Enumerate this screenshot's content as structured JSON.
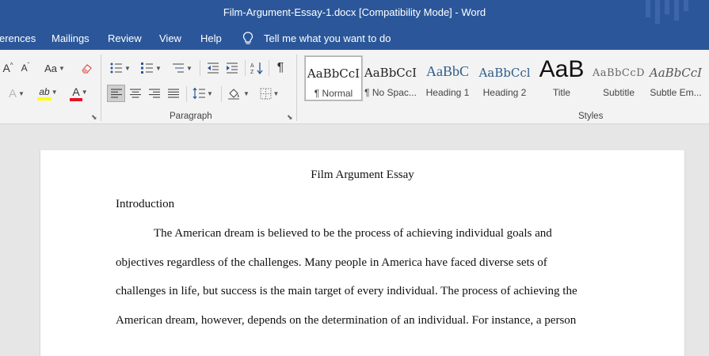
{
  "window": {
    "title": "Film-Argument-Essay-1.docx [Compatibility Mode]  -  Word"
  },
  "menu": {
    "items": [
      "erences",
      "Mailings",
      "Review",
      "View",
      "Help"
    ],
    "tell_me": "Tell me what you want to do"
  },
  "ribbon": {
    "groups": {
      "paragraph": "Paragraph",
      "styles": "Styles"
    },
    "font_buttons": {
      "grow": "A",
      "shrink": "A",
      "case": "Aa",
      "effects": "A",
      "highlight": "ab",
      "font_color": "A"
    },
    "pilcrow": "¶",
    "styles": [
      {
        "preview": "AaBbCcI",
        "name": "¶ Normal"
      },
      {
        "preview": "AaBbCcI",
        "name": "¶ No Spac..."
      },
      {
        "preview": "AaBbC",
        "name": "Heading 1"
      },
      {
        "preview": "AaBbCcl",
        "name": "Heading 2"
      },
      {
        "preview": "AaB",
        "name": "Title"
      },
      {
        "preview": "AaBbCcD",
        "name": "Subtitle"
      },
      {
        "preview": "AaBbCcI",
        "name": "Subtle Em..."
      }
    ]
  },
  "colors": {
    "accent": "#2b579a",
    "highlight": "#ffff00",
    "font_color": "#e81123"
  },
  "document": {
    "title": "Film Argument Essay",
    "heading": "Introduction",
    "lines": [
      "The American dream is believed to be the process of achieving individual goals and",
      "objectives regardless of the challenges. Many people in America have faced diverse sets of",
      "challenges in life, but success is the main target of every individual. The process of achieving the",
      "American dream, however, depends on the determination of an individual. For instance, a person"
    ]
  }
}
